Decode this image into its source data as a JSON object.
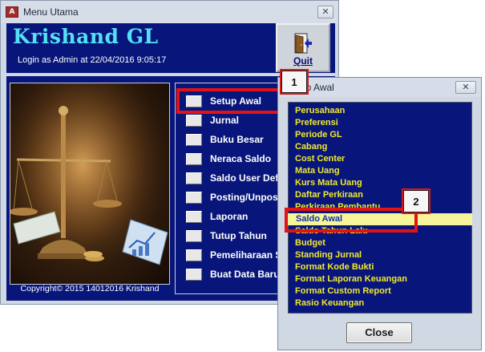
{
  "main_window": {
    "title": "Menu Utama",
    "close_glyph": "✕",
    "app_title": "Krishand GL",
    "login_text": "Login as Admin at 22/04/2016 9:05:17",
    "quit_label": "Quit",
    "copyright": "Copyright© 2015 14012016 Krishand",
    "menu_items": [
      {
        "label": "Setup Awal"
      },
      {
        "label": "Jurnal"
      },
      {
        "label": "Buku Besar"
      },
      {
        "label": "Neraca Saldo"
      },
      {
        "label": "Saldo User Def"
      },
      {
        "label": "Posting/Unposting"
      },
      {
        "label": "Laporan"
      },
      {
        "label": "Tutup Tahun"
      },
      {
        "label": "Pemeliharaan S"
      },
      {
        "label": "Buat Data Baru"
      }
    ]
  },
  "dialog": {
    "title": "Setup Awal",
    "close_glyph": "✕",
    "items": [
      {
        "label": "Perusahaan"
      },
      {
        "label": "Preferensi"
      },
      {
        "label": "Periode GL"
      },
      {
        "label": "Cabang"
      },
      {
        "label": "Cost Center"
      },
      {
        "label": "Mata Uang"
      },
      {
        "label": "Kurs Mata Uang"
      },
      {
        "label": "Daftar Perkiraan"
      },
      {
        "label": "Perkiraan Pembantu"
      },
      {
        "label": "Saldo Awal",
        "selected": true
      },
      {
        "label": "Saldo Tahun Lalu"
      },
      {
        "label": "Budget"
      },
      {
        "label": "Standing Jurnal"
      },
      {
        "label": "Format Kode Bukti"
      },
      {
        "label": "Format Laporan Keuangan"
      },
      {
        "label": "Format Custom Report"
      },
      {
        "label": "Rasio Keuangan"
      }
    ],
    "close_button": "Close"
  },
  "annotations": {
    "callout_1": "1",
    "callout_2": "2",
    "highlight_color": "#e11313"
  },
  "colors": {
    "panel_navy": "#08167b",
    "title_cyan": "#54e0f5",
    "list_yellow": "#f2e92c",
    "selection_bg": "#f7f59a"
  }
}
